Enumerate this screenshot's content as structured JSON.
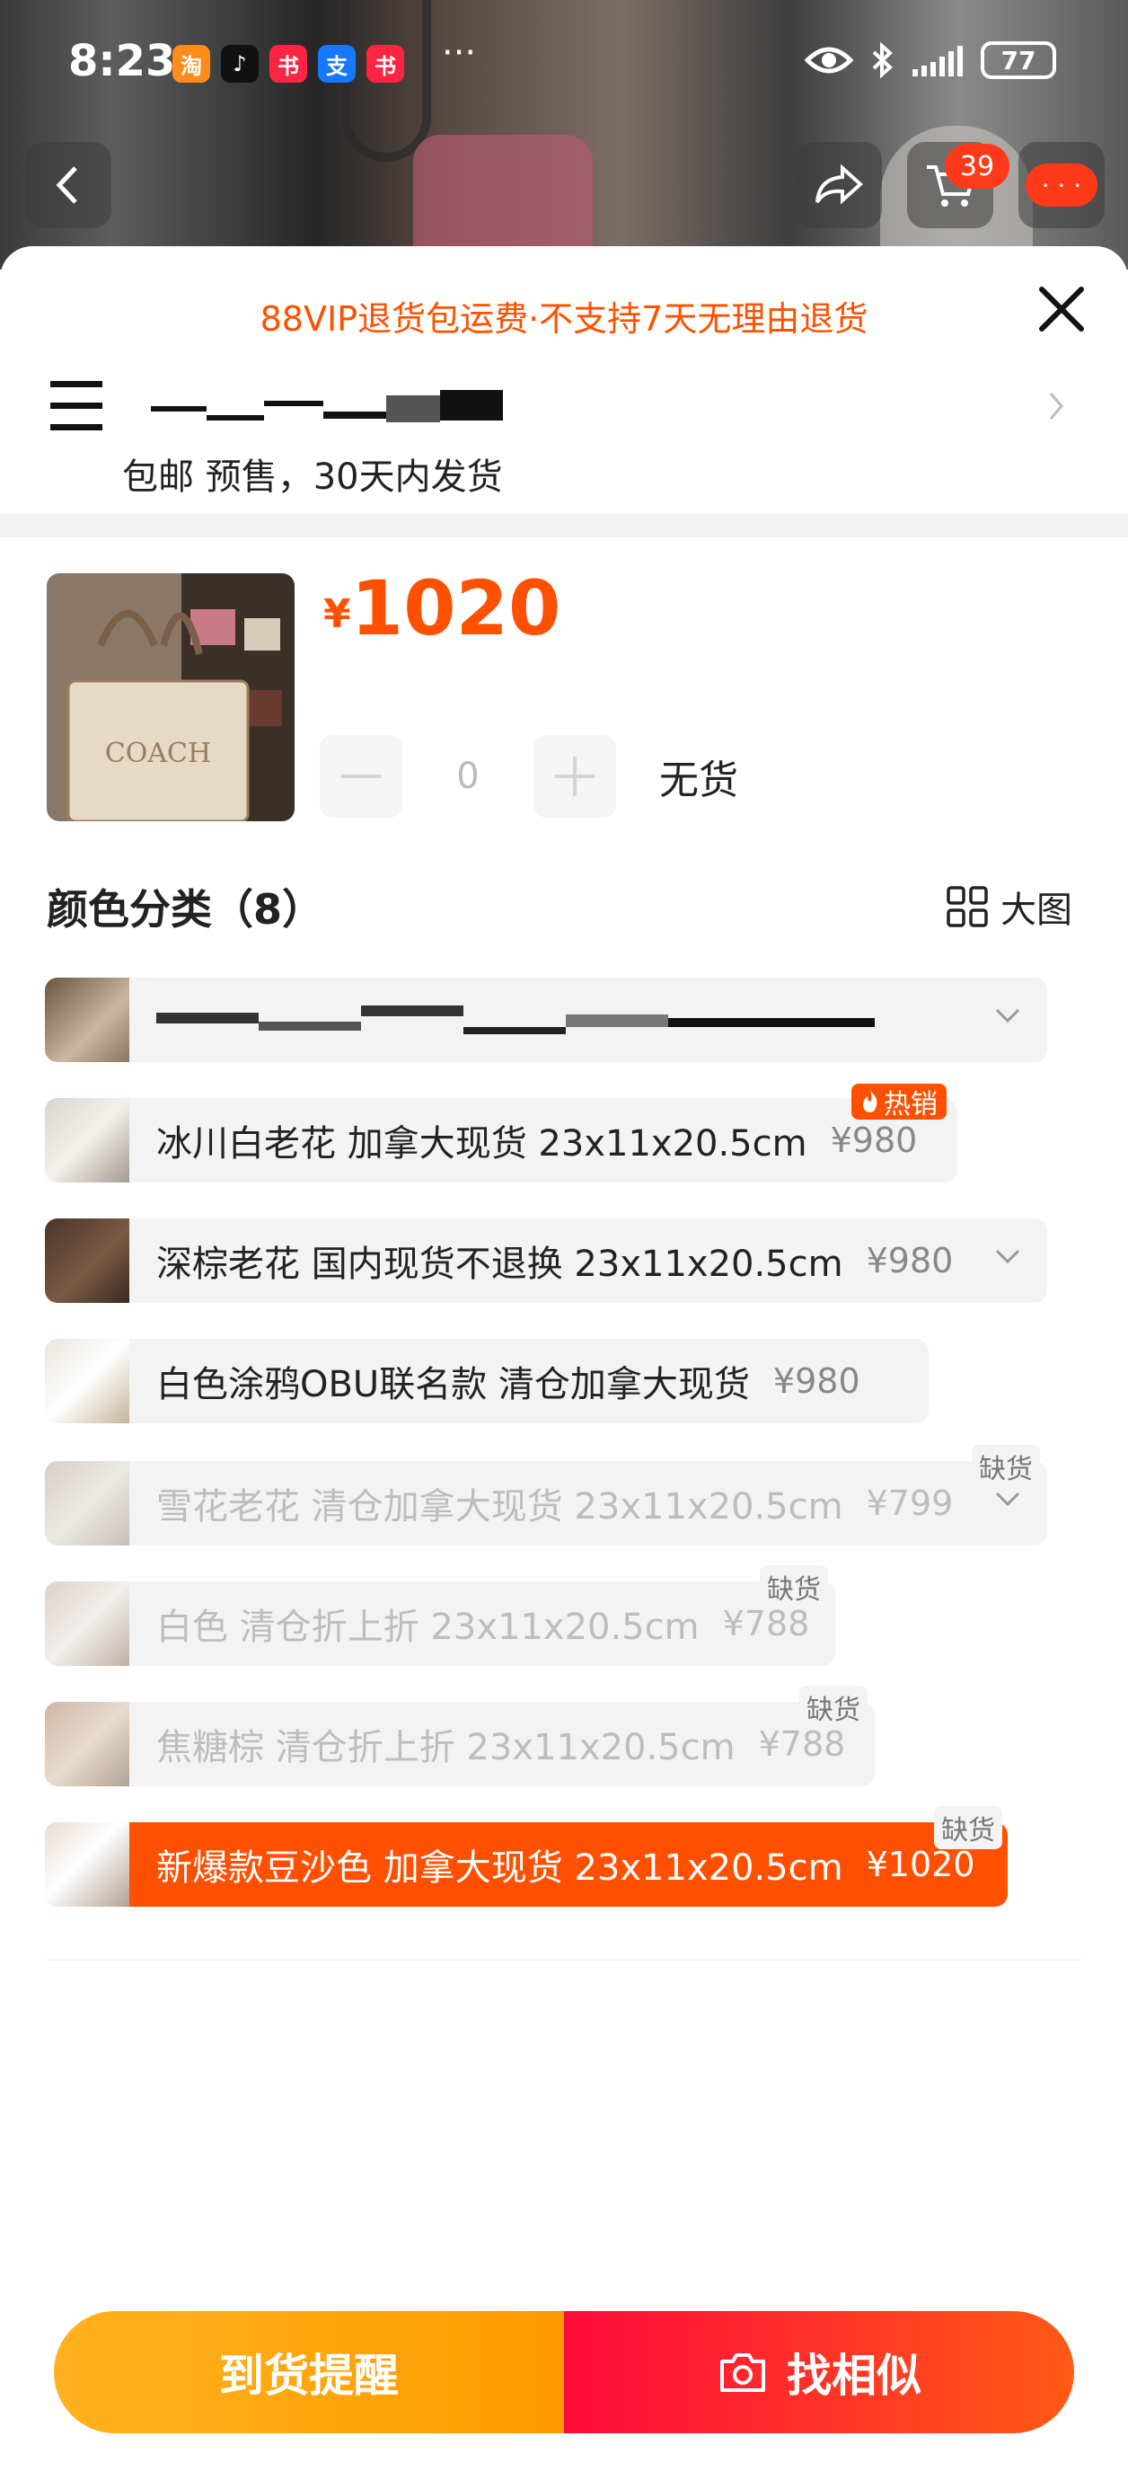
{
  "status_bar": {
    "time": "8:23",
    "apps": [
      {
        "icon": "taobao-app-icon",
        "glyph": "淘",
        "color": "#ff8c1a"
      },
      {
        "icon": "tiktok-app-icon",
        "glyph": "♪",
        "color": "#111111"
      },
      {
        "icon": "xiaohongshu-app-icon",
        "glyph": "书",
        "color": "#ff2442"
      },
      {
        "icon": "alipay-app-icon",
        "glyph": "支",
        "color": "#1677ff"
      },
      {
        "icon": "xiaohongshu-app-icon-2",
        "glyph": "书",
        "color": "#ff2442"
      }
    ],
    "more": "···",
    "battery": "77"
  },
  "header": {
    "cart_count": "39"
  },
  "sheet": {
    "vip_notice": "88VIP退货包运费·不支持7天无理由退货",
    "shipping": "包邮 预售，30天内发货",
    "price_symbol": "¥",
    "price": "1020",
    "quantity": "0",
    "stock_status": "无货",
    "color_title": "颜色分类（8）",
    "big_view_label": "大图"
  },
  "options": [
    {
      "label": "",
      "price": "",
      "redacted": true
    },
    {
      "label": "冰川白老花 加拿大现货 23x11x20.5cm",
      "price": "¥980",
      "badge": "热销"
    },
    {
      "label": "深棕老花 国内现货不退换 23x11x20.5cm",
      "price": "¥980"
    },
    {
      "label": "白色涂鸦OBU联名款 清仓加拿大现货",
      "price": "¥980"
    },
    {
      "label": "雪花老花 清仓加拿大现货 23x11x20.5cm",
      "price": "¥799",
      "stock_tag": "缺货"
    },
    {
      "label": "白色 清仓折上折 23x11x20.5cm",
      "price": "¥788",
      "stock_tag": "缺货"
    },
    {
      "label": "焦糖棕 清仓折上折 23x11x20.5cm",
      "price": "¥788",
      "stock_tag": "缺货"
    },
    {
      "label": "新爆款豆沙色 加拿大现货 23x11x20.5cm",
      "price": "¥1020",
      "stock_tag": "缺货"
    }
  ],
  "footer": {
    "notify_label": "到货提醒",
    "similar_label": "找相似"
  },
  "colors": {
    "accent": "#ff5000",
    "notify_gradient_start": "#ffb21e",
    "similar_gradient_start": "#ff0a3c"
  }
}
